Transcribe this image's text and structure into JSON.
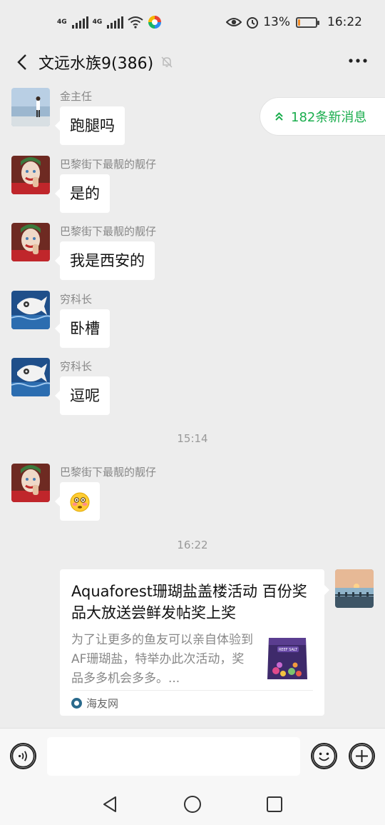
{
  "status_bar": {
    "net1": "4G",
    "net2": "4G",
    "battery_percent": "13%",
    "battery_level": 0.13,
    "time": "16:22",
    "icons": [
      "signal-icon",
      "signal-icon",
      "wifi-icon",
      "app-notification-icon",
      "eye-icon",
      "alarm-icon",
      "battery-icon"
    ]
  },
  "header": {
    "back_icon": "chevron-left-icon",
    "title": "文远水族9(386)",
    "mute_icon": "bell-off-icon",
    "more_icon": "more-dots-icon"
  },
  "new_messages": {
    "label": "182条新消息",
    "icon": "double-chevron-up-icon"
  },
  "messages": [
    {
      "sender": "金主任",
      "text": "跑腿吗"
    },
    {
      "sender": "巴黎街下最靓的靓仔",
      "text": "是的"
    },
    {
      "sender": "巴黎街下最靓的靓仔",
      "text": "我是西安的"
    },
    {
      "sender": "穷科长",
      "text": "卧槽"
    },
    {
      "sender": "穷科长",
      "text": "逗呢"
    },
    {
      "sender": "巴黎街下最靓的靓仔",
      "emoji": "😳"
    }
  ],
  "timestamps": [
    "15:14",
    "16:22"
  ],
  "link_card": {
    "title": "Aquaforest珊瑚盐盖楼活动 百份奖品大放送尝鲜发帖奖上奖",
    "description": "为了让更多的鱼友可以亲自体验到AF珊瑚盐，特举办此次活动，奖品多多机会多多。...",
    "source": "海友网",
    "thumb_label": "REEF SALT"
  },
  "input_bar": {
    "voice_icon": "voice-icon",
    "emoji_icon": "emoji-icon",
    "add_icon": "plus-circle-icon",
    "value": ""
  },
  "nav_bar": {
    "icons": [
      "back-triangle-icon",
      "home-circle-icon",
      "recents-square-icon"
    ]
  },
  "colors": {
    "background": "#ededed",
    "bubble": "#ffffff",
    "accent_green": "#1aad4d",
    "battery_low": "#f08a24"
  }
}
